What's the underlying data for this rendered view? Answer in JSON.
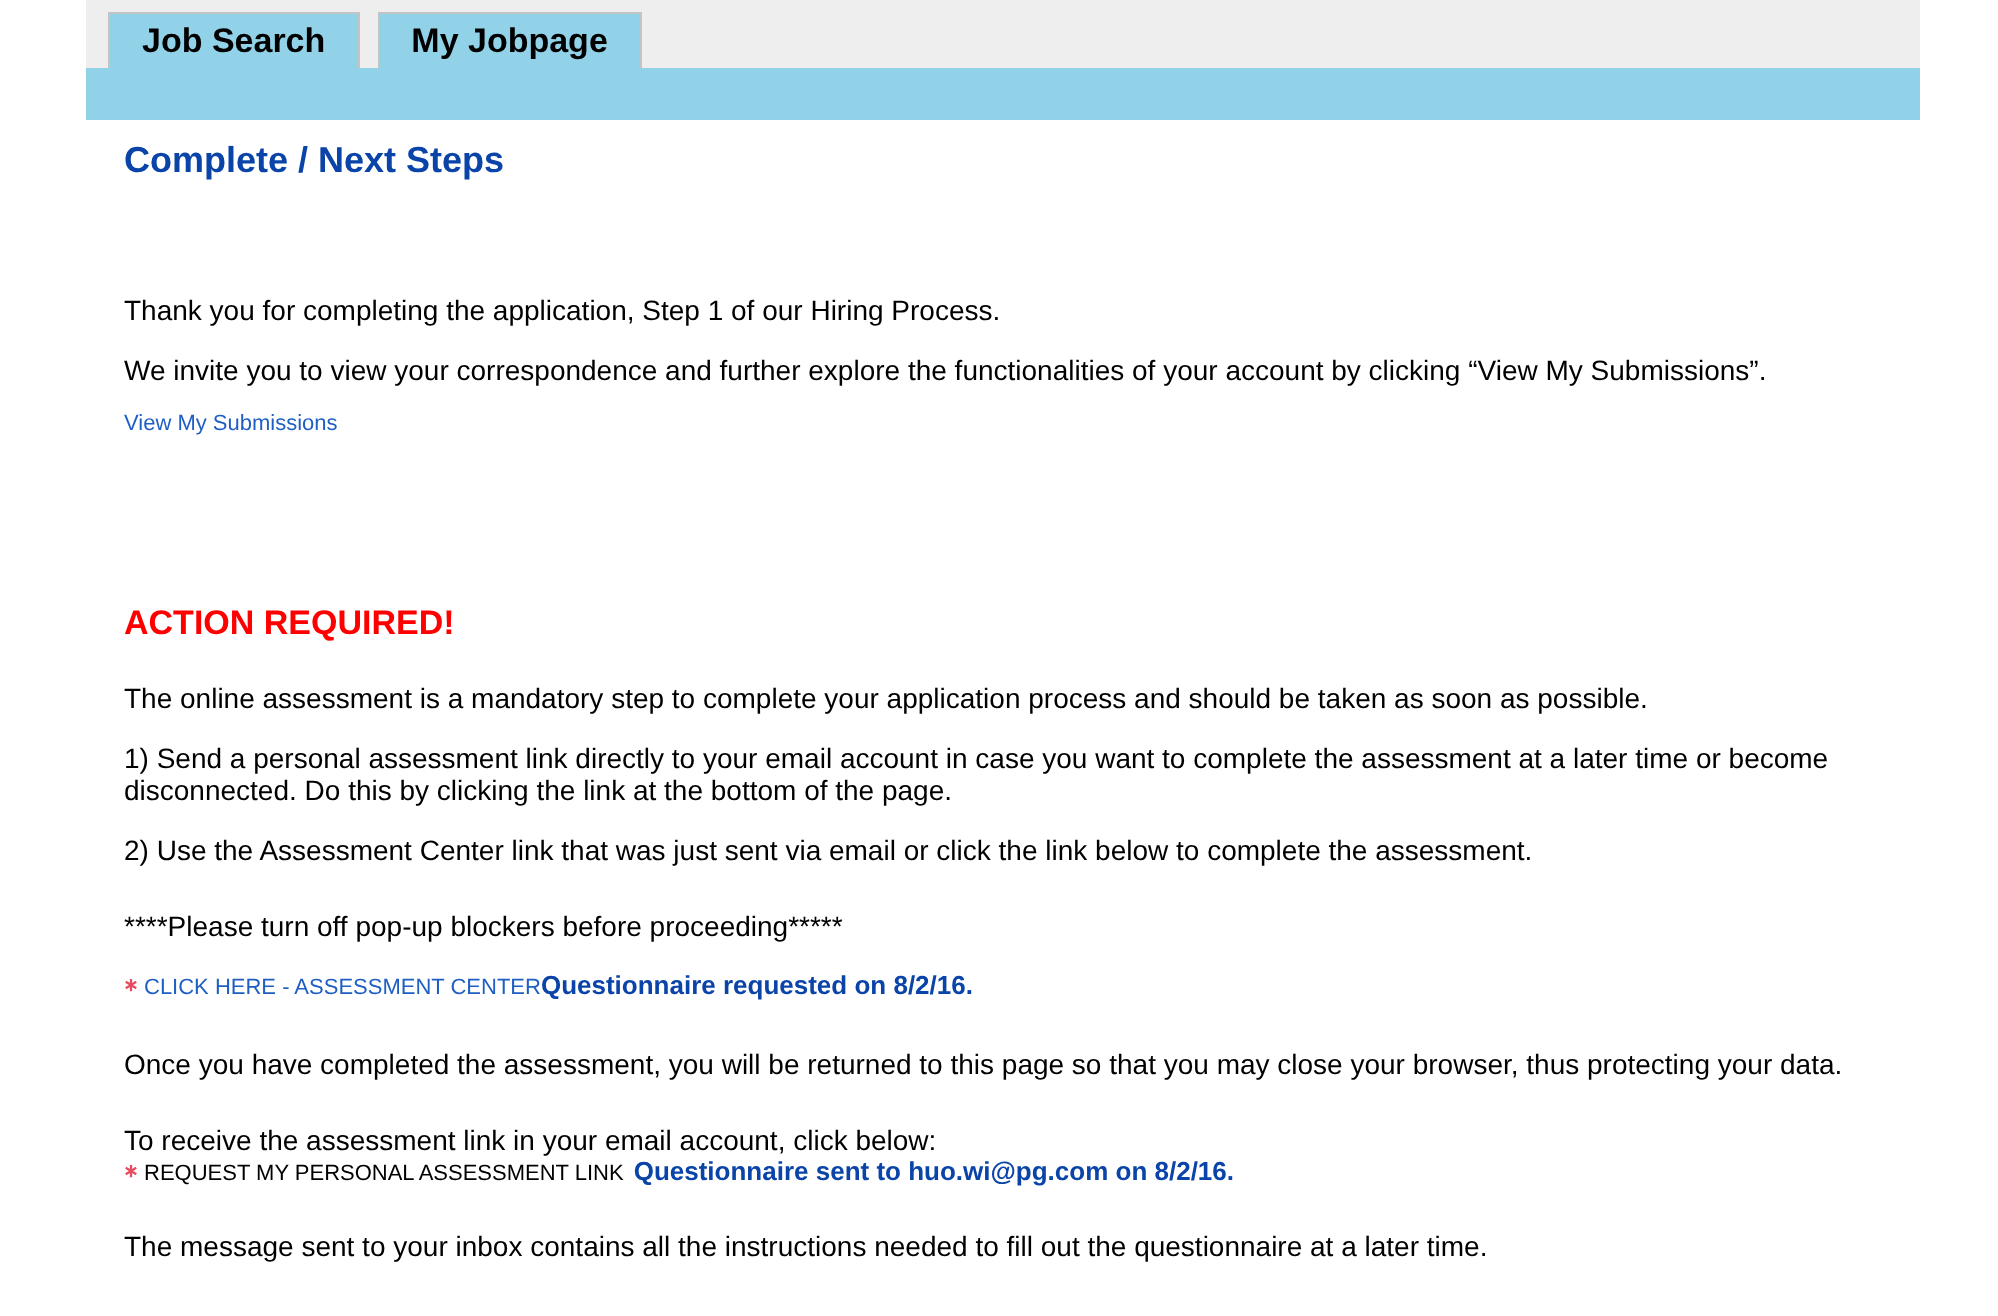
{
  "tabs": [
    {
      "label": "Job Search",
      "selected": false
    },
    {
      "label": "My Jobpage",
      "selected": false
    }
  ],
  "heading": "Complete / Next Steps",
  "intro": [
    "Thank you for completing the application, Step 1 of our Hiring Process.",
    "We invite you to view your correspondence and further explore the functionalities of your account by clicking “View My Submissions”."
  ],
  "submissions_link": "View My Submissions",
  "alert": "ACTION REQUIRED!",
  "instructions": [
    "The online assessment is a mandatory step to complete your application process and should be taken as soon as possible.",
    "1) Send a personal assessment link directly to your email account in case you want to complete the assessment at a later time or become disconnected. Do this by clicking the link at the bottom of the page.",
    "2) Use the Assessment Center link that was just sent via email or click the link below to complete the assessment."
  ],
  "popup_note": "****Please turn off pop-up blockers before proceeding*****",
  "assessment_link": {
    "label": "CLICK HERE - ASSESSMENT CENTER",
    "status": "Questionnaire requested on 8/2/16."
  },
  "return_note": "Once you have completed the assessment, you will be returned to this page so that you may close your browser, thus protecting your data.",
  "email_prompt": "To receive the assessment link in your email account, click below:",
  "email_link": {
    "label": "REQUEST MY PERSONAL ASSESSMENT LINK",
    "status": "Questionnaire sent to huo.wi@pg.com on 8/2/16."
  },
  "footer_note": "The message sent to your inbox contains all the instructions needed to fill out the questionnaire at a later time."
}
